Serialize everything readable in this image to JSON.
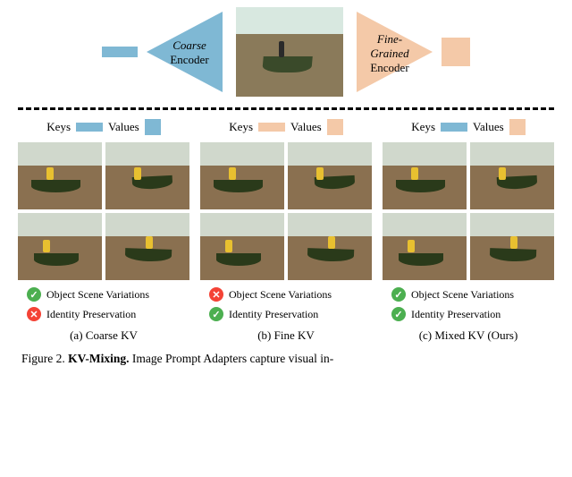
{
  "encoders": {
    "coarse_label_line1": "Coarse",
    "coarse_label_line2": "Encoder",
    "fine_label_line1": "Fine-",
    "fine_label_line2": "Grained",
    "fine_label_line3": "Encoder"
  },
  "kv_header": {
    "keys_label": "Keys",
    "values_label": "Values"
  },
  "badges": {
    "variation": "Object Scene Variations",
    "identity": "Identity Preservation",
    "check": "✓",
    "cross": "✕"
  },
  "columns": [
    {
      "sub_caption": "(a) Coarse KV",
      "variation_ok": true,
      "identity_ok": false,
      "keys_color": "blue",
      "values_color": "blue"
    },
    {
      "sub_caption": "(b) Fine KV",
      "variation_ok": false,
      "identity_ok": true,
      "keys_color": "orange",
      "values_color": "orange"
    },
    {
      "sub_caption": "(c) Mixed KV (Ours)",
      "variation_ok": true,
      "identity_ok": true,
      "keys_color": "blue",
      "values_color": "orange"
    }
  ],
  "caption": {
    "fig_label": "Figure 2. ",
    "bold_title": "KV-Mixing. ",
    "rest": "Image Prompt Adapters capture visual in-"
  }
}
